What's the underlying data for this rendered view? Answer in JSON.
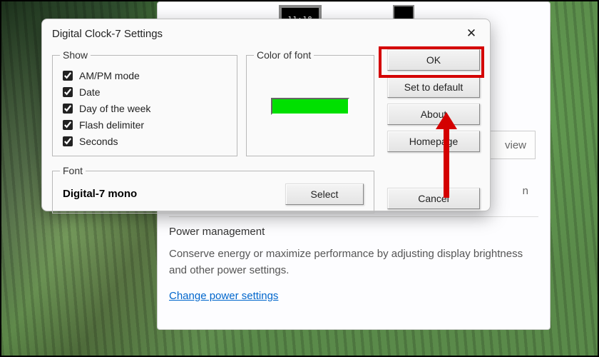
{
  "background_window": {
    "clock_preview_time": "11:18",
    "view_btn_visible_text": "view",
    "stray_char": "n",
    "power": {
      "heading": "Power management",
      "desc": "Conserve energy or maximize performance by adjusting display brightness and other power settings.",
      "link": "Change power settings"
    }
  },
  "dialog": {
    "title": "Digital Clock-7 Settings",
    "groups": {
      "show_legend": "Show",
      "color_legend": "Color of font",
      "font_legend": "Font"
    },
    "show_options": [
      {
        "label": "AM/PM mode",
        "checked": true
      },
      {
        "label": "Date",
        "checked": true
      },
      {
        "label": "Day of the week",
        "checked": true
      },
      {
        "label": "Flash delimiter",
        "checked": true
      },
      {
        "label": "Seconds",
        "checked": true
      }
    ],
    "font_color": "#00e000",
    "font_name": "Digital-7 mono",
    "buttons": {
      "select": "Select",
      "ok": "OK",
      "set_default": "Set to default",
      "about": "About",
      "homepage": "Homepage",
      "cancel": "Cancel"
    }
  },
  "annotations": {
    "ok_highlight": true,
    "arrow_points_to": "ok-button"
  }
}
